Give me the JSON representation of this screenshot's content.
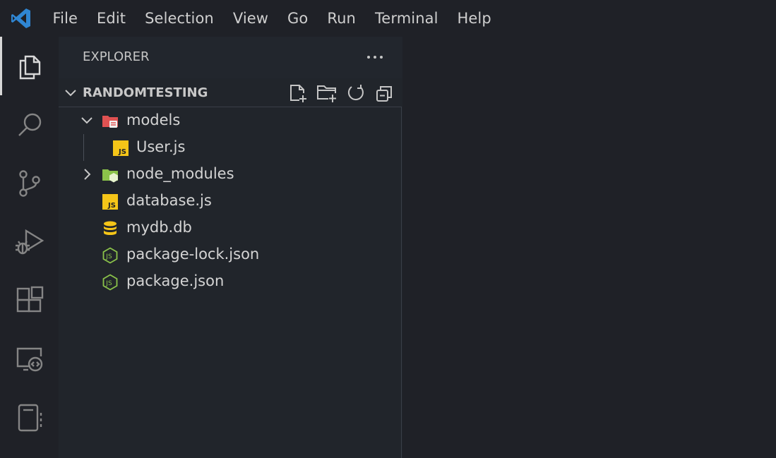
{
  "menu": [
    "File",
    "Edit",
    "Selection",
    "View",
    "Go",
    "Run",
    "Terminal",
    "Help"
  ],
  "activity_bar": [
    {
      "name": "explorer-icon",
      "active": true
    },
    {
      "name": "search-icon",
      "active": false
    },
    {
      "name": "source-control-icon",
      "active": false
    },
    {
      "name": "run-debug-icon",
      "active": false
    },
    {
      "name": "extensions-icon",
      "active": false
    },
    {
      "name": "remote-explorer-icon",
      "active": false
    },
    {
      "name": "notebook-icon",
      "active": false
    }
  ],
  "sidebar": {
    "title": "EXPLORER",
    "more_label": "···",
    "section_title": "RANDOMTESTING",
    "section_actions": [
      "new-file-icon",
      "new-folder-icon",
      "refresh-icon",
      "collapse-all-icon"
    ]
  },
  "tree": [
    {
      "label": "models",
      "kind": "folder",
      "expanded": true,
      "depth": 0,
      "icon": "models-folder-icon",
      "color": "#e05252"
    },
    {
      "label": "User.js",
      "kind": "file",
      "depth": 1,
      "icon": "javascript-file-icon",
      "color": "#f5c518"
    },
    {
      "label": "node_modules",
      "kind": "folder",
      "expanded": false,
      "depth": 0,
      "icon": "node-modules-folder-icon",
      "color": "#8bc34a"
    },
    {
      "label": "database.js",
      "kind": "file",
      "depth": 0,
      "icon": "javascript-file-icon",
      "color": "#f5c518"
    },
    {
      "label": "mydb.db",
      "kind": "file",
      "depth": 0,
      "icon": "database-icon",
      "color": "#f5c518"
    },
    {
      "label": "package-lock.json",
      "kind": "file",
      "depth": 0,
      "icon": "nodejs-icon",
      "color": "#8bc34a"
    },
    {
      "label": "package.json",
      "kind": "file",
      "depth": 0,
      "icon": "nodejs-icon",
      "color": "#8bc34a"
    }
  ],
  "colors": {
    "accent": "#2f86d3",
    "background": "#1f2127",
    "sidebar": "#21252b"
  }
}
